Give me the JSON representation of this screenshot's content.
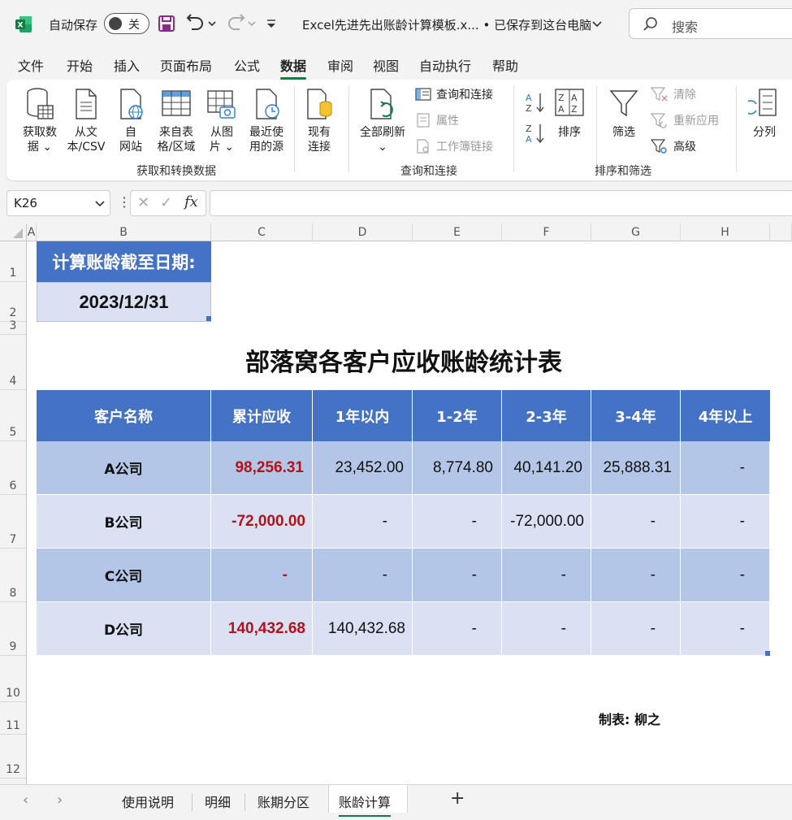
{
  "titlebar": {
    "autosave_label": "自动保存",
    "autosave_state": "关",
    "document_title": "Excel先进先出账龄计算模板.x... • 已保存到这台电脑",
    "search_placeholder": "搜索",
    "icons": [
      "excel-logo-icon",
      "save-icon",
      "undo-icon",
      "redo-icon",
      "customize-qat-icon",
      "title-chevron-down-icon",
      "search-icon"
    ]
  },
  "menu": {
    "tabs": [
      "文件",
      "开始",
      "插入",
      "页面布局",
      "公式",
      "数据",
      "审阅",
      "视图",
      "自动执行",
      "帮助"
    ],
    "active": "数据"
  },
  "ribbon": {
    "get_data_group": {
      "label": "获取和转换数据",
      "buttons": [
        {
          "line1": "获取数",
          "line2": "据 ⌄",
          "icon": "database-icon"
        },
        {
          "line1": "从文",
          "line2": "本/CSV",
          "icon": "text-file-icon"
        },
        {
          "line1": "自",
          "line2": "网站",
          "icon": "web-icon"
        },
        {
          "line1": "来自表",
          "line2": "格/区域",
          "icon": "table-icon"
        },
        {
          "line1": "从图",
          "line2": "片 ⌄",
          "icon": "picture-icon"
        },
        {
          "line1": "最近使",
          "line2": "用的源",
          "icon": "recent-sources-icon"
        },
        {
          "line1": "现有",
          "line2": "连接",
          "icon": "existing-connections-icon"
        }
      ]
    },
    "queries_group": {
      "label": "查询和连接",
      "refresh_all_line1": "全部刷新",
      "refresh_all_line2": "⌄",
      "queries_connections": "查询和连接",
      "properties": "属性",
      "edit_links": "工作簿链接"
    },
    "sort_group": {
      "label": "排序和筛选",
      "sort": "排序",
      "filter": "筛选",
      "clear": "清除",
      "reapply": "重新应用",
      "advanced": "高级"
    },
    "data_tools": {
      "text_to_columns": "分列"
    }
  },
  "formula_bar": {
    "name_box": "K26",
    "dots": "⋮",
    "cancel": "✕",
    "enter": "✓",
    "fx": "fx",
    "formula": ""
  },
  "sheet": {
    "columns": [
      "A",
      "B",
      "C",
      "D",
      "E",
      "F",
      "G",
      "H"
    ],
    "rows": [
      "1",
      "2",
      "3",
      "4",
      "5",
      "6",
      "7",
      "8",
      "9",
      "10",
      "11",
      "12"
    ],
    "cutoff_label": "计算账龄截至日期:",
    "cutoff_date": "2023/12/31",
    "report_title": "部落窝各客户应收账龄统计表",
    "table": {
      "headers": [
        "客户名称",
        "累计应收",
        "1年以内",
        "1-2年",
        "2-3年",
        "3-4年",
        "4年以上"
      ],
      "rows": [
        {
          "name": "A公司",
          "total": "98,256.31",
          "y1": "23,452.00",
          "y2": "8,774.80",
          "y3": "40,141.20",
          "y4": "25,888.31",
          "y5": "-"
        },
        {
          "name": "B公司",
          "total": "-72,000.00",
          "y1": "-",
          "y2": "-",
          "y3": "-72,000.00",
          "y4": "-",
          "y5": "-"
        },
        {
          "name": "C公司",
          "total": "-",
          "y1": "-",
          "y2": "-",
          "y3": "-",
          "y4": "-",
          "y5": "-"
        },
        {
          "name": "D公司",
          "total": "140,432.68",
          "y1": "140,432.68",
          "y2": "-",
          "y3": "-",
          "y4": "-",
          "y5": "-"
        }
      ]
    },
    "maker": "制表: 柳之"
  },
  "sheet_tabs": {
    "tabs": [
      "使用说明",
      "明细",
      "账期分区",
      "账龄计算"
    ],
    "active": "账龄计算",
    "add": "+",
    "prev": "‹",
    "next": "›"
  },
  "colors": {
    "header_blue": "#4472c4",
    "row_dark": "#b4c6e7",
    "row_light": "#d9e1f2",
    "total_red": "#b4121b",
    "excel_green": "#107c41"
  }
}
